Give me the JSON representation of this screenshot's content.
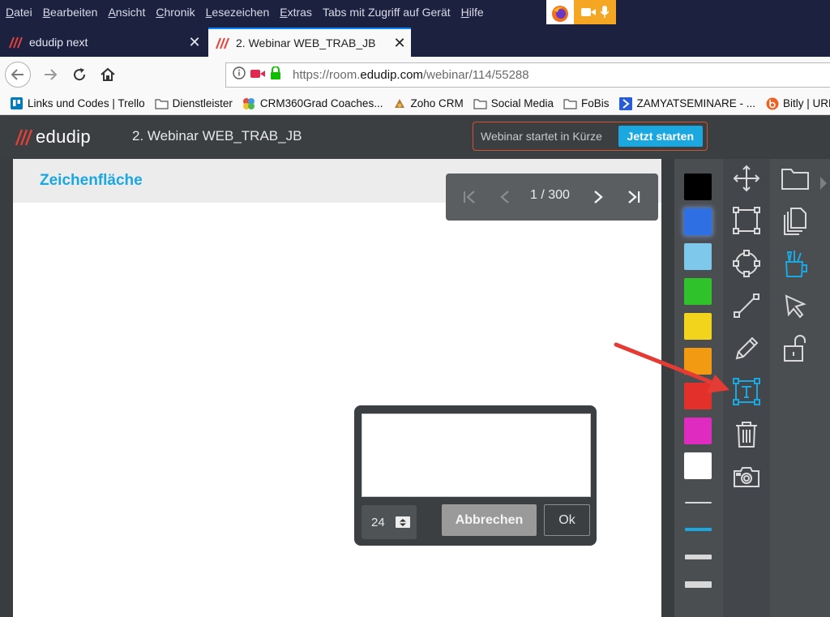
{
  "menubar": {
    "items": [
      {
        "u": "D",
        "rest": "atei"
      },
      {
        "u": "B",
        "rest": "earbeiten"
      },
      {
        "u": "A",
        "rest": "nsicht"
      },
      {
        "u": "C",
        "rest": "hronik"
      },
      {
        "u": "L",
        "rest": "esezeichen"
      },
      {
        "u": "E",
        "rest": "xtras"
      },
      {
        "u": "",
        "rest": "Tabs mit Zugriff auf Gerät"
      },
      {
        "u": "H",
        "rest": "ilfe"
      }
    ]
  },
  "tabs": [
    {
      "title": "edudip next",
      "icon": "edudip-icon",
      "active": false
    },
    {
      "title": "2. Webinar WEB_TRAB_JB",
      "icon": "edudip-icon",
      "active": true
    }
  ],
  "urlbar": {
    "prefix": "https://room.",
    "domain": "edudip.com",
    "path": "/webinar/114/55288"
  },
  "bookmarks": [
    {
      "label": "Links und Codes | Trello",
      "icon": "trello-icon"
    },
    {
      "label": "Dienstleister",
      "icon": "folder-icon"
    },
    {
      "label": "CRM360Grad Coaches...",
      "icon": "crm360-icon"
    },
    {
      "label": "Zoho CRM",
      "icon": "zoho-icon"
    },
    {
      "label": "Social Media",
      "icon": "folder-icon"
    },
    {
      "label": "FoBis",
      "icon": "folder-icon"
    },
    {
      "label": "ZAMYATSEMINARE - ...",
      "icon": "zamyat-icon"
    },
    {
      "label": "Bitly | URL",
      "icon": "bitly-icon"
    }
  ],
  "app": {
    "logo_text": "edudip",
    "webinar_title": "2. Webinar WEB_TRAB_JB",
    "start_status": "Webinar startet in Kürze",
    "start_button": "Jetzt starten",
    "accent": "#1ba7e0"
  },
  "whiteboard": {
    "title": "Zeichenfläche",
    "page_indicator": "1 / 300"
  },
  "text_dialog": {
    "text_value": "",
    "font_size": "24",
    "cancel_label": "Abbrechen",
    "ok_label": "Ok"
  },
  "colors": [
    {
      "name": "black",
      "hex": "#000000",
      "selected": false
    },
    {
      "name": "blue",
      "hex": "#2f6fe4",
      "selected": true
    },
    {
      "name": "light-blue",
      "hex": "#7ec9eb",
      "selected": false
    },
    {
      "name": "green",
      "hex": "#2fc22a",
      "selected": false
    },
    {
      "name": "yellow",
      "hex": "#f1d41b",
      "selected": false
    },
    {
      "name": "orange",
      "hex": "#f29a12",
      "selected": false
    },
    {
      "name": "red",
      "hex": "#e3302a",
      "selected": false
    },
    {
      "name": "magenta",
      "hex": "#e02bc0",
      "selected": false
    },
    {
      "name": "white",
      "hex": "#ffffff",
      "selected": false
    }
  ],
  "tools": [
    "move-icon",
    "rectangle-icon",
    "circle-icon",
    "line-icon",
    "pencil-icon",
    "text-tool-icon",
    "trash-icon",
    "camera-icon"
  ],
  "active_tool": "text-tool-icon",
  "side_tools": [
    "folder-icon",
    "copy-pages-icon",
    "pens-cup-icon",
    "pointer-icon",
    "unlock-icon"
  ]
}
